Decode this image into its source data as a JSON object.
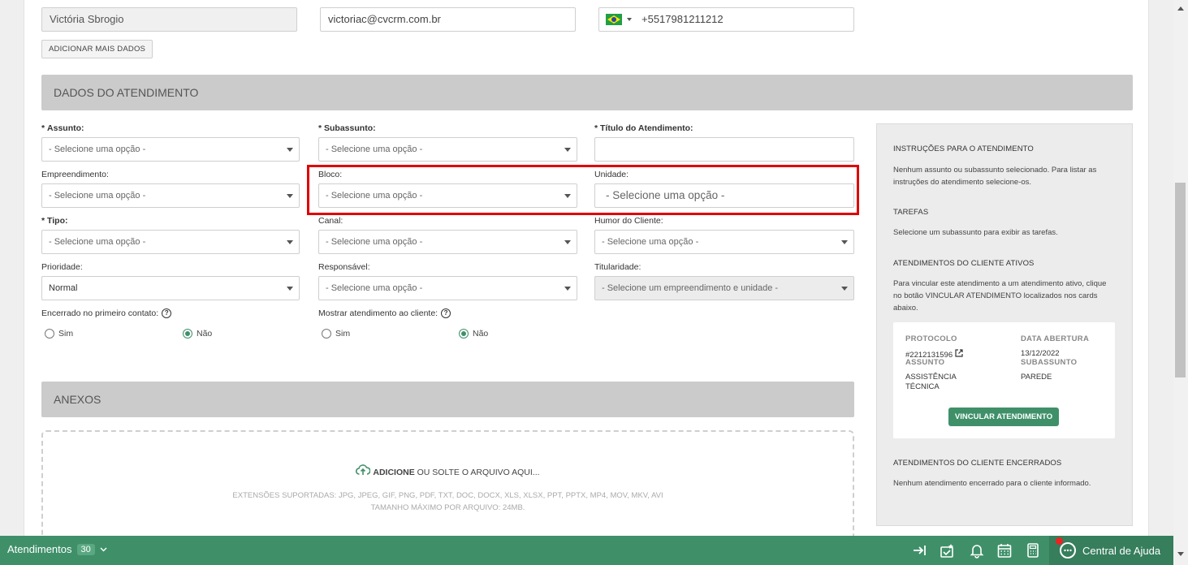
{
  "contact": {
    "name": "Victória Sbrogio",
    "email": "victoriac@cvcrm.com.br",
    "phone": "+5517981211212",
    "add_more_label": "ADICIONAR MAIS DADOS"
  },
  "sections": {
    "dados": "DADOS DO ATENDIMENTO",
    "anexos": "ANEXOS"
  },
  "fields": {
    "assunto_label": "Assunto:",
    "subassunto_label": "Subassunto:",
    "titulo_label": "Título do Atendimento:",
    "empreendimento_label": "Empreendimento:",
    "bloco_label": "Bloco:",
    "unidade_label": "Unidade:",
    "tipo_label": "Tipo:",
    "canal_label": "Canal:",
    "humor_label": "Humor do Cliente:",
    "prioridade_label": "Prioridade:",
    "responsavel_label": "Responsável:",
    "titularidade_label": "Titularidade:",
    "placeholder": "- Selecione uma opção -",
    "prioridade_value": "Normal",
    "titularidade_placeholder": "- Selecione um empreendimento e unidade -",
    "encerrado_label": "Encerrado no primeiro contato:",
    "mostrar_label": "Mostrar atendimento ao cliente:",
    "sim": "Sim",
    "nao": "Não",
    "required_mark": "*"
  },
  "upload": {
    "action": "ADICIONE",
    "rest": " OU SOLTE O ARQUIVO AQUI...",
    "extensions": "EXTENSÕES SUPORTADAS: JPG, JPEG, GIF, PNG, PDF, TXT, DOC, DOCX, XLS, XLSX, PPT, PPTX, MP4, MOV, MKV, AVI",
    "max_size": "TAMANHO MÁXIMO POR ARQUIVO: 24MB."
  },
  "sidebar": {
    "instr_title": "INSTRUÇÕES PARA O ATENDIMENTO",
    "instr_text": "Nenhum assunto ou subassunto selecionado. Para listar as instruções do atendimento selecione-os.",
    "tarefas_title": "TAREFAS",
    "tarefas_text": "Selecione um subassunto para exibir as tarefas.",
    "ativos_title": "ATENDIMENTOS DO CLIENTE ATIVOS",
    "ativos_text": "Para vincular este atendimento a um atendimento ativo, clique no botão VINCULAR ATENDIMENTO localizados nos cards abaixo.",
    "card": {
      "protocolo_label": "PROTOCOLO",
      "protocolo_value": "#2212131596",
      "data_label": "DATA ABERTURA",
      "data_value": "13/12/2022",
      "assunto_label": "ASSUNTO",
      "assunto_value": "ASSISTÊNCIA TÉCNICA",
      "subassunto_label": "SUBASSUNTO",
      "subassunto_value": "PAREDE",
      "button": "VINCULAR ATENDIMENTO"
    },
    "encerrados_title": "ATENDIMENTOS DO CLIENTE ENCERRADOS",
    "encerrados_text": "Nenhum atendimento encerrado para o cliente informado."
  },
  "bottombar": {
    "label": "Atendimentos",
    "count": "30",
    "help": "Central de Ajuda"
  },
  "colors": {
    "accent": "#3f9069",
    "highlight": "#e00000"
  }
}
